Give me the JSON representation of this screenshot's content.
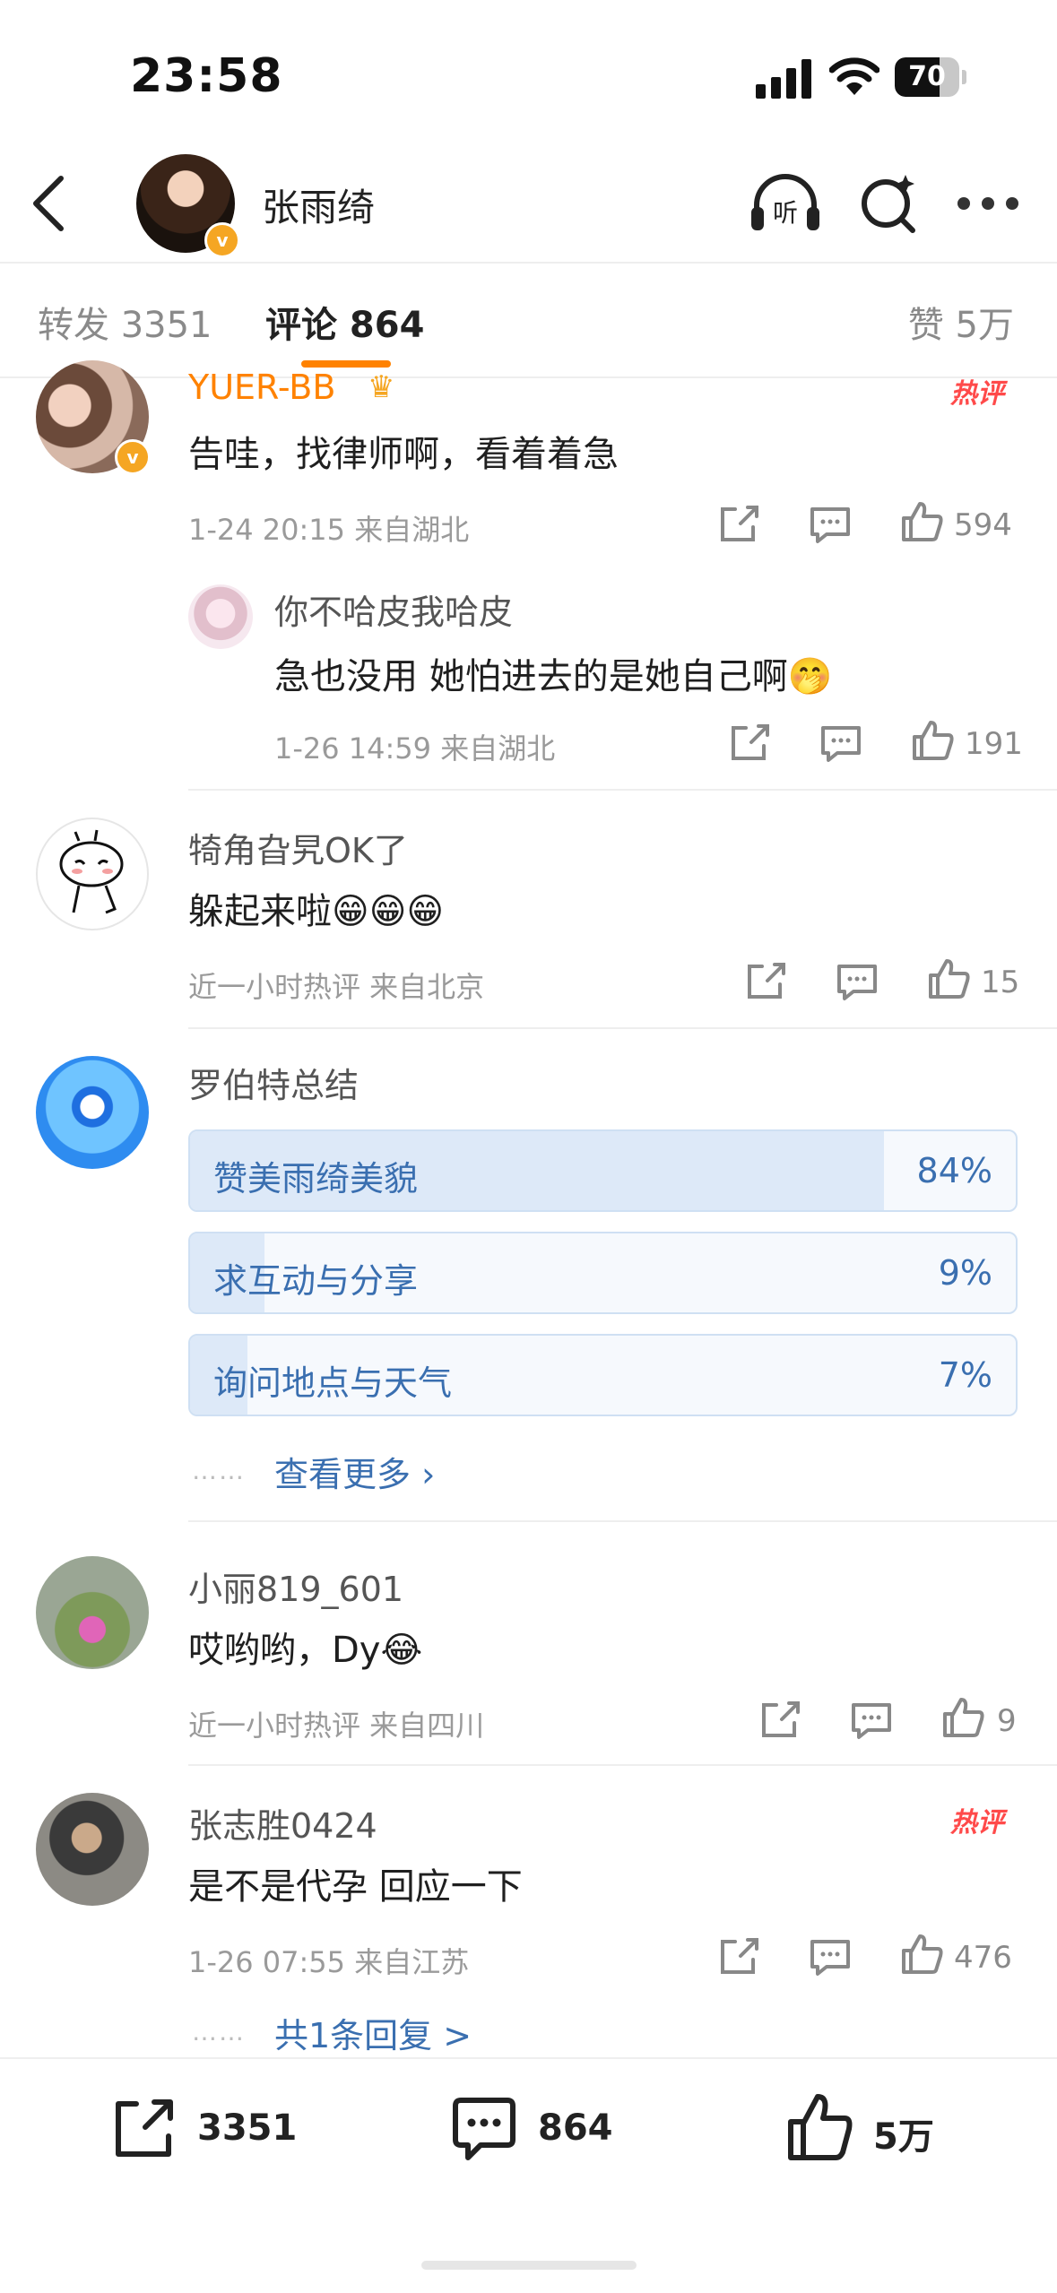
{
  "status_bar": {
    "time": "23:58",
    "battery": "70",
    "battery_level": 0.7
  },
  "nav": {
    "title": "张雨绮",
    "listen_icon_label": "听"
  },
  "tabs": [
    {
      "label": "转发 3351"
    },
    {
      "label": "评论 864"
    }
  ],
  "tab_likes": "赞 5万",
  "comments": [
    {
      "user": "YUER-BB",
      "text": "告哇，找律师啊，看着着急",
      "meta": "1-24 20:15  来自湖北",
      "likes": "594",
      "hot_badge": "热评",
      "reply": {
        "user": "你不哈皮我哈皮",
        "text": "急也没用 她怕进去的是她自己啊",
        "emoji": "🤭",
        "meta": "1-26 14:59  来自湖北",
        "likes": "191"
      }
    },
    {
      "user": "犄角旮旯OK了",
      "text": "躲起来啦",
      "emoji": "😁😁😁",
      "meta": "近一小时热评  来自北京",
      "likes": "15"
    },
    {
      "user": "罗伯特总结",
      "poll": [
        {
          "label": "赞美雨绮美貌",
          "pct": "84%",
          "value": 0.84
        },
        {
          "label": "求互动与分享",
          "pct": "9%",
          "value": 0.09
        },
        {
          "label": "询问地点与天气",
          "pct": "7%",
          "value": 0.07
        }
      ],
      "more": "查看更多 ›"
    },
    {
      "user": "小丽819_601",
      "text": "哎哟哟，Dy",
      "emoji": "😂",
      "meta": "近一小时热评  来自四川",
      "likes": "9"
    },
    {
      "user": "张志胜0424",
      "text": "是不是代孕 回应一下",
      "meta": "1-26 07:55  来自江苏",
      "likes": "476",
      "hot_badge": "热评",
      "replies_link": "共1条回复 >"
    }
  ],
  "leader_dots": "……",
  "bottom_bar": {
    "reposts": "3351",
    "comments": "864",
    "likes": "5万"
  },
  "colors": {
    "accent": "#ff8200",
    "link": "#3a6fb0",
    "hot": "#ff4a4a"
  }
}
